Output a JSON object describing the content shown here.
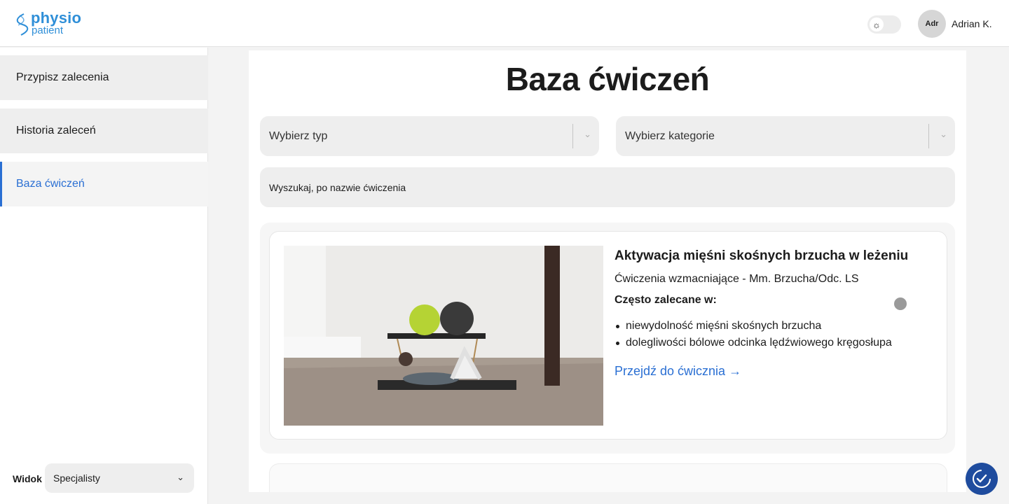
{
  "header": {
    "logo_top": "physio",
    "logo_bottom": "patient",
    "theme_icon": "sun-icon",
    "avatar_initials": "Adr",
    "user_name": "Adrian K."
  },
  "sidebar": {
    "items": [
      {
        "label": "Przypisz zalecenia",
        "active": false
      },
      {
        "label": "Historia zaleceń",
        "active": false
      },
      {
        "label": "Baza ćwiczeń",
        "active": true
      }
    ],
    "view_label": "Widok",
    "view_value": "Specjalisty"
  },
  "main": {
    "title": "Baza ćwiczeń",
    "type_select_placeholder": "Wybierz typ",
    "category_select_placeholder": "Wybierz kategorie",
    "search_placeholder": "Wyszukaj, po nazwie ćwiczenia",
    "exercise": {
      "title": "Aktywacja mięśni skośnych brzucha w leżeniu",
      "subtitle": "Ćwiczenia wzmacniające - Mm. Brzucha/Odc. LS",
      "often_label": "Często zalecane w:",
      "conditions": [
        "niewydolność mięśni skośnych brzucha",
        "dolegliwości bólowe odcinka lędźwiowego kręgosłupa"
      ],
      "link_label": "Przejdź do ćwicznia →"
    }
  },
  "colors": {
    "accent": "#2a6fd3",
    "logo": "#2f8fd8",
    "fab": "#1f4c9e"
  },
  "fab_icon": "accessibility-check-icon"
}
